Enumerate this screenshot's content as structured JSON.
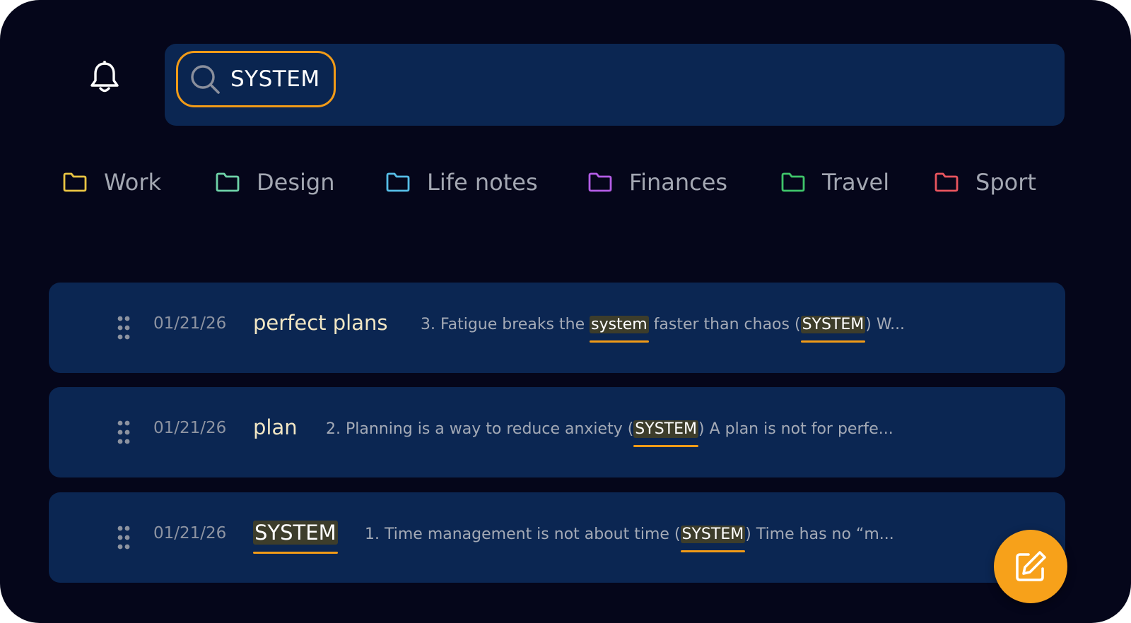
{
  "search": {
    "query": "SYSTEM",
    "accent_color": "#f29b17"
  },
  "header": {
    "bell_icon": "bell-icon",
    "search_icon": "search-icon"
  },
  "folders": [
    {
      "label": "Work",
      "color": "#e9c443",
      "icon": "folder-icon"
    },
    {
      "label": "Design",
      "color": "#6ed2a8",
      "icon": "folder-icon"
    },
    {
      "label": "Life notes",
      "color": "#56bde6",
      "icon": "folder-icon"
    },
    {
      "label": "Finances",
      "color": "#b45de6",
      "icon": "folder-icon"
    },
    {
      "label": "Travel",
      "color": "#3fc46a",
      "icon": "folder-icon"
    },
    {
      "label": "Sport",
      "color": "#e8545e",
      "icon": "folder-icon"
    }
  ],
  "notes": [
    {
      "date": "01/21/26",
      "title": "perfect plans",
      "excerpt": {
        "p1": "3. Fatigue breaks the ",
        "h1": "system",
        "p2": " faster than chaos (",
        "h2": "SYSTEM",
        "p3": ") W..."
      }
    },
    {
      "date": "01/21/26",
      "title": "plan",
      "excerpt": {
        "p1": "2. Planning is a way to reduce anxiety (",
        "h1": "SYSTEM",
        "p2": ") A plan is not for perfe..."
      }
    },
    {
      "date": "01/21/26",
      "title": "SYSTEM",
      "excerpt": {
        "p1": "1. Time management is not about time (",
        "h1": "SYSTEM",
        "p2": ") Time has no “m..."
      }
    }
  ],
  "fab": {
    "icon": "edit-icon",
    "color": "#f7a11a"
  }
}
